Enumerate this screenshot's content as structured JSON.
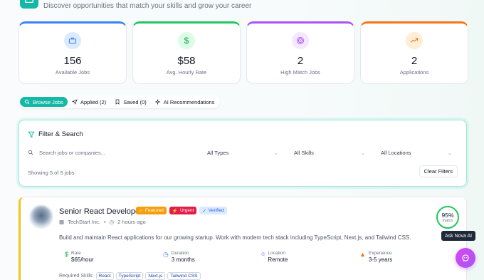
{
  "header": {
    "subtitle": "Discover opportunities that match your skills and grow your career"
  },
  "stats": [
    {
      "value": "156",
      "label": "Available Jobs",
      "color": "#3b82f6"
    },
    {
      "value": "$58",
      "label": "Avg. Hourly Rate",
      "color": "#22c55e"
    },
    {
      "value": "2",
      "label": "High Match Jobs",
      "color": "#a855f7"
    },
    {
      "value": "2",
      "label": "Applications",
      "color": "#f97316"
    }
  ],
  "tabs": [
    {
      "label": "Browse Jobs",
      "active": true
    },
    {
      "label": "Applied (2)"
    },
    {
      "label": "Saved (0)"
    },
    {
      "label": "AI Recommendations"
    }
  ],
  "filter": {
    "title": "Filter & Search",
    "search_placeholder": "Search jobs or companies...",
    "types": "All Types",
    "skills": "All Skills",
    "locations": "All Locations",
    "showing": "Showing 5 of 5 jobs",
    "clear_label": "Clear Filters"
  },
  "job": {
    "title": "Senior React Developer",
    "badges": {
      "featured": "Featured",
      "urgent": "Urgent",
      "verified": "Verified"
    },
    "company": "TechStart Inc.",
    "posted": "2 hours ago",
    "description": "Build and maintain React applications for our growing startup. Work with modern tech stack including TypeScript, Next.js, and Tailwind CSS.",
    "match_pct": "95%",
    "match_label": "match",
    "rate_label": "Rate",
    "rate": "$65/hour",
    "duration_label": "Duration",
    "duration": "3 months",
    "location_label": "Location",
    "location": "Remote",
    "experience_label": "Experience",
    "experience": "3-5 years",
    "skills_label": "Required Skills:",
    "skills": [
      "React",
      "TypeScript",
      "Next.js",
      "Tailwind CSS"
    ]
  },
  "assistant": {
    "tooltip": "Ask Nova AI"
  }
}
